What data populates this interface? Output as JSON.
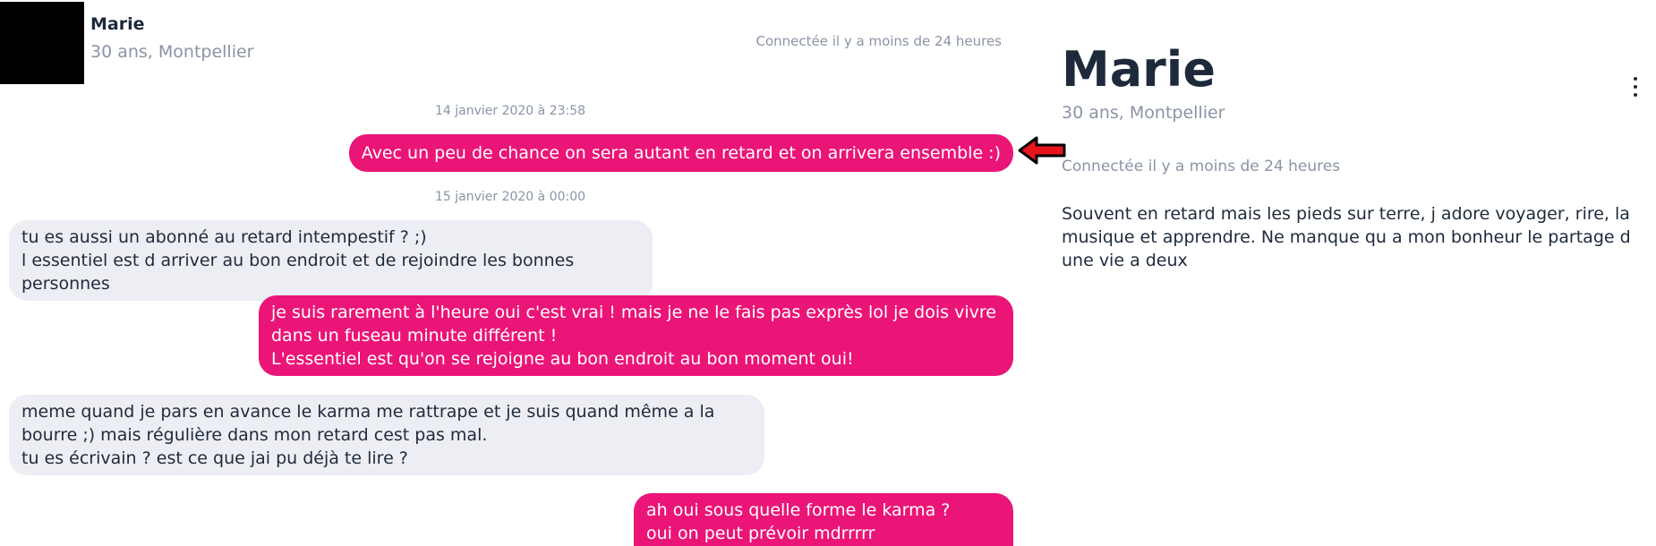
{
  "conversation": {
    "header": {
      "name": "Marie",
      "subtitle": "30 ans, Montpellier",
      "status": "Connectée il y a moins de 24 heures"
    },
    "timestamps": [
      "14 janvier 2020 à 23:58",
      "15 janvier 2020 à 00:00"
    ],
    "messages": [
      {
        "direction": "out",
        "text": "Avec un peu de chance on sera autant en retard et on arrivera ensemble :)"
      },
      {
        "direction": "in",
        "text": "tu es aussi un abonné au retard intempestif ? ;)\nl essentiel est d arriver au bon endroit et de rejoindre les bonnes personnes"
      },
      {
        "direction": "out",
        "text": "je suis rarement à l'heure oui c'est vrai ! mais je ne le fais pas exprès lol je dois vivre dans un fuseau minute différent !\nL'essentiel est qu'on se rejoigne au bon endroit au bon moment oui!"
      },
      {
        "direction": "in",
        "text": "meme quand je pars en avance le karma me rattrape et je suis quand même a la bourre ;) mais régulière dans mon retard cest pas mal.\ntu es écrivain ? est ce que jai pu déjà te lire ?"
      },
      {
        "direction": "out",
        "text": "ah oui sous quelle forme le karma ?\noui on peut prévoir mdrrrrr"
      }
    ],
    "colors": {
      "outgoing": "#ea1577",
      "incoming": "#edeef3"
    }
  },
  "profile": {
    "name": "Marie",
    "subtitle": "30 ans, Montpellier",
    "status": "Connectée il y a moins de 24 heures",
    "bio": "Souvent en retard mais les pieds sur terre, j adore voyager, rire, la musique et apprendre. Ne manque qu a mon bonheur le partage d une vie a deux",
    "menu_icon": "kebab-menu-icon"
  },
  "annotation": {
    "icon": "red-arrow-icon",
    "color": "#e8141c"
  }
}
